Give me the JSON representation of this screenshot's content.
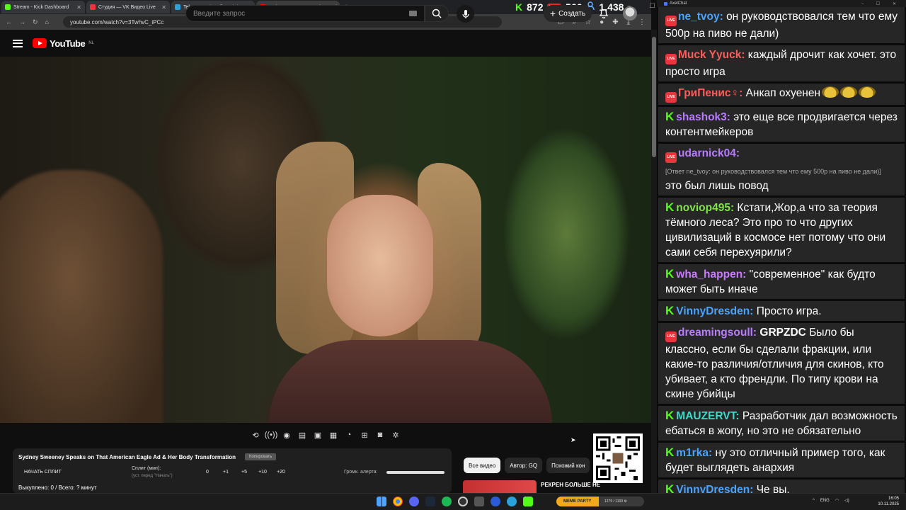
{
  "browser": {
    "tabs": [
      {
        "title": "Stream - Kick Dashboard",
        "favicon_color": "#53fc18"
      },
      {
        "title": "Студия — VK Видео Live",
        "favicon_color": "#e8363c"
      },
      {
        "title": "Telegram: View @russiainmyms",
        "favicon_color": "#2aa2d9"
      },
      {
        "title": "Sydney Sweeney Speaks on That",
        "favicon_color": "#ff0000"
      }
    ],
    "new_tab": "+",
    "url": "youtube.com/watch?v=3TwhvC_iPCc"
  },
  "stream_stats": {
    "kick_icon": "K",
    "kick_count": "872",
    "vk_icon": "LIVE",
    "vk_count": "566",
    "viewers_icon": "person-icon",
    "viewers_count": "1,438"
  },
  "youtube": {
    "logo_text": "YouTube",
    "region": "NL",
    "search_placeholder": "Введите запрос",
    "create_label": "Создать",
    "create_plus": "+"
  },
  "split_panel": {
    "title": "Sydney Sweeney Speaks on That American Eagle Ad & Her Body Transformation",
    "copy_label": "Копировать",
    "start_split": "НАЧАТЬ СПЛИТ",
    "split_label": "Сплит (мин):",
    "split_hint": "(уст. перед \"Начать\")",
    "values": [
      "0",
      "+1",
      "+5",
      "+10",
      "+20"
    ],
    "alert_volume_label": "Громк. алерта:",
    "alert_volume": 1.0,
    "bought": "Выкуплено: 0 / Всего: ? минут"
  },
  "recommendations": {
    "chips": [
      "Все видео",
      "Автор: GQ",
      "Похожий кон"
    ],
    "first_title": "РЕКРЕН БОЛЬШЕ НЕ"
  },
  "chat": {
    "app_title": "AxelChat",
    "messages": [
      {
        "platform": "vk",
        "nick": "ne_tvoy:",
        "color": "#4aa3ff",
        "text": "он руководствовался тем что ему 500р на пиво не дали)"
      },
      {
        "platform": "vk",
        "nick": "Muck Yyuck:",
        "color": "#ff5c5c",
        "text": "каждый дрочит как хочет. это просто игра"
      },
      {
        "platform": "vk",
        "nick": "ГриПенис♀:",
        "color": "#ff5c5c",
        "text": "Анкап охуенен",
        "emotes": 3
      },
      {
        "platform": "kick",
        "nick": "shashok3:",
        "color": "#b97cff",
        "text": "это еще все продвигается через контентмейкеров"
      },
      {
        "platform": "vk",
        "nick": "udarnick04:",
        "color": "#b97cff",
        "reply": "[Ответ ne_tvoy: он руководствовался тем что ему 500р на пиво не дали)]",
        "text": "это был лишь повод"
      },
      {
        "platform": "kick",
        "nick": "noviop495:",
        "color": "#7fe34a",
        "text": "Кстати,Жор,а что за теория тёмного леса? Это про то что других цивилизаций в космосе нет потому что они сами себя перехуярили?"
      },
      {
        "platform": "kick",
        "nick": "wha_happen:",
        "color": "#c97cff",
        "text": "\"современное\" как будто может быть иначе"
      },
      {
        "platform": "kick",
        "nick": "VinnyDresden:",
        "color": "#4aa3ff",
        "text": "Просто игра."
      },
      {
        "platform": "vk",
        "nick": "dreamingsoull:",
        "color": "#b97cff",
        "bold_prefix": "GRPZDC",
        "text": "Было бы классно, если бы сделали фракции, или какие-то различия/отличия для скинов, кто убивает, а кто френдли. По типу крови на скине убийцы"
      },
      {
        "platform": "kick",
        "nick": "MAUZERVT:",
        "color": "#3fd9c9",
        "text": "Разработчик дал возможность ебаться в жопу, но это не обязательно"
      },
      {
        "platform": "kick",
        "nick": "m1rka:",
        "color": "#4aa3ff",
        "text": "ну это отличный пример того, как будет выглядеть анархия"
      },
      {
        "platform": "kick",
        "nick": "VinnyDresden:",
        "color": "#4aa3ff",
        "text": "Че вы."
      }
    ]
  },
  "taskbar": {
    "app_label": "МЕМЕ PARTY",
    "app_sub": "1275 / 1100 ⚙",
    "lang": "ENG",
    "time": "16:05",
    "date": "10.11.2025"
  }
}
